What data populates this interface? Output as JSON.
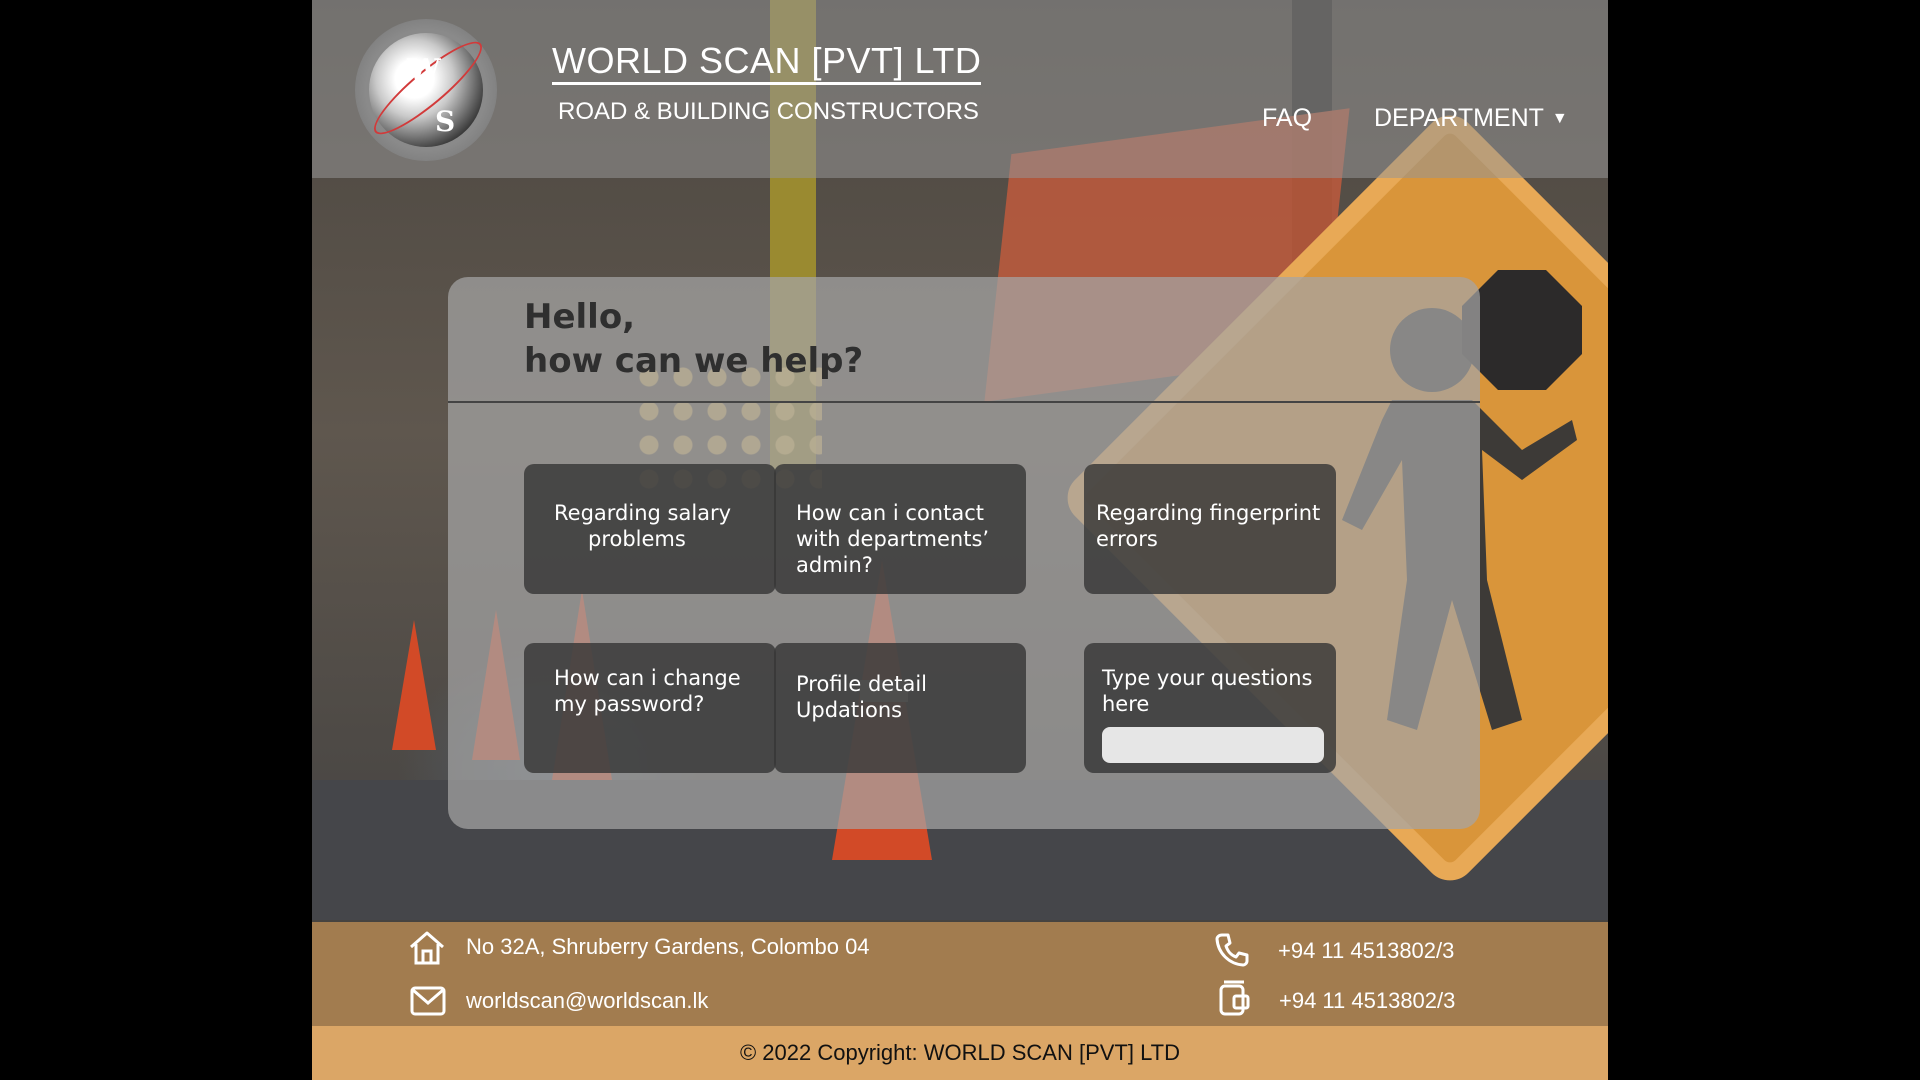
{
  "header": {
    "brand_title": "WORLD SCAN [PVT] LTD",
    "brand_subtitle": "ROAD & BUILDING CONSTRUCTORS",
    "logo_letters": [
      "W",
      "S"
    ],
    "nav": {
      "faq_label": "FAQ",
      "department_label": "DEPARTMENT",
      "department_caret": "▼"
    }
  },
  "help": {
    "greeting_line1": "Hello,",
    "greeting_line2": "how can we help?",
    "tiles": [
      {
        "lines": [
          "Regarding salary",
          "problems"
        ]
      },
      {
        "lines": [
          "How can i  contact",
          "with departments’",
          "admin?"
        ]
      },
      {
        "lines": [
          "Regarding fingerprint",
          "errors"
        ]
      },
      {
        "lines": [
          "How can i change",
          "my password?"
        ]
      },
      {
        "lines": [
          "Profile detail",
          "Updations"
        ]
      },
      {
        "lines": [
          "Type your questions",
          "here"
        ]
      }
    ],
    "question_input": {
      "value": "",
      "placeholder": ""
    }
  },
  "footer": {
    "address": "No 32A, Shruberry Gardens, Colombo 04",
    "email": "worldscan@worldscan.lk",
    "phone": "+94 11 4513802/3",
    "fax": "+94 11 4513802/3",
    "icons": [
      "home-icon",
      "mail-icon",
      "phone-icon",
      "fax-icon"
    ],
    "copyright": "© 2022 Copyright: WORLD SCAN [PVT] LTD"
  },
  "colors": {
    "footer_bg": "#a27c4f",
    "copyright_bg": "#dba666",
    "tile_bg": "#373737",
    "card_bg": "#a5a5a5"
  }
}
